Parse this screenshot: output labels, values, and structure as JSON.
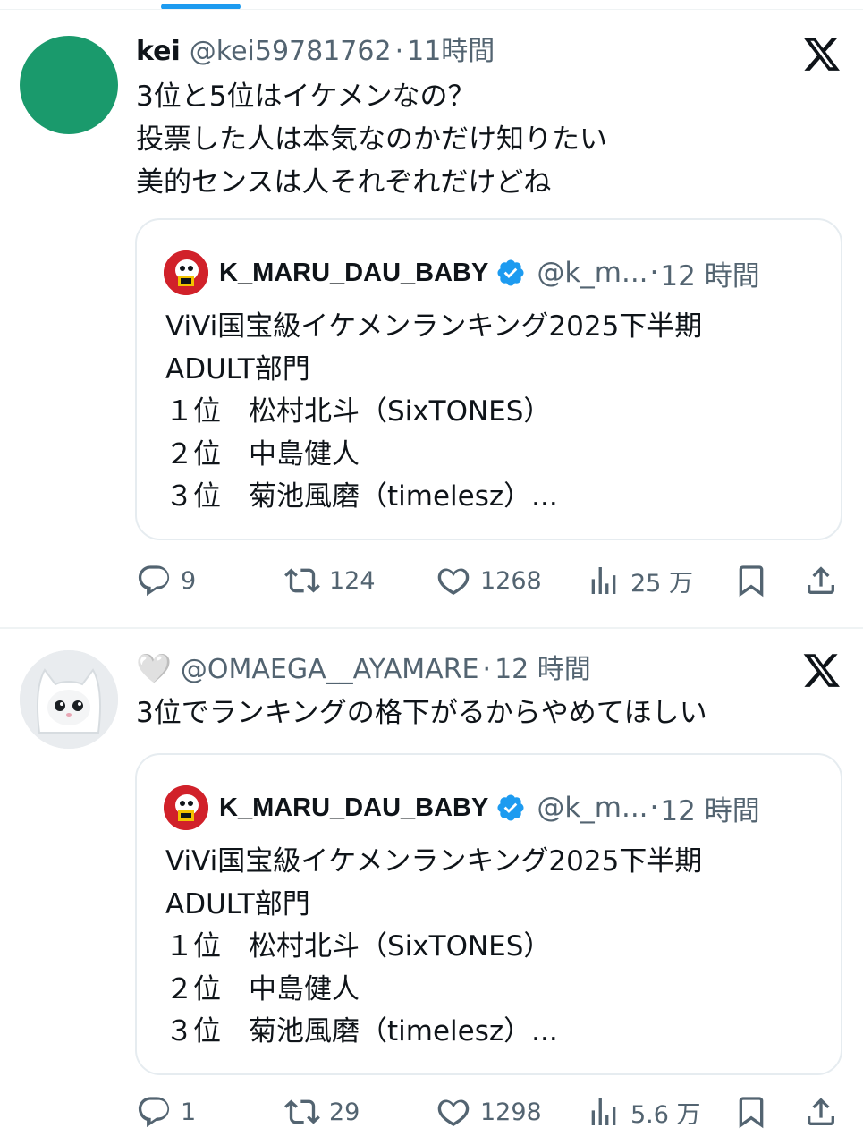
{
  "tweets": [
    {
      "name": "kei",
      "handle": "@kei59781762",
      "dot": "·",
      "time": "11時間",
      "text": "3位と5位はイケメンなの？\n投票した人は本気なのかだけ知りたい\n美的センスは人それぞれだけどね",
      "quote": {
        "name": "K_MARU_DAU_BABY",
        "handle": "@k_m...",
        "dot": "·",
        "time": "12 時間",
        "text": "ViVi国宝級イケメンランキング2025下半期\nADULT部門\n１位　松村北斗（SixTONES）\n２位　中島健人\n３位　菊池風磨（timelesz）..."
      },
      "stats": {
        "replies": "9",
        "retweets": "124",
        "likes": "1268",
        "views": "25 万"
      }
    },
    {
      "name": "🤍",
      "handle": "@OMAEGA__AYAMARE",
      "dot": "·",
      "time": "12 時間",
      "text": "3位でランキングの格下がるからやめてほしい",
      "quote": {
        "name": "K_MARU_DAU_BABY",
        "handle": "@k_m...",
        "dot": "·",
        "time": "12 時間",
        "text": "ViVi国宝級イケメンランキング2025下半期\nADULT部門\n１位　松村北斗（SixTONES）\n２位　中島健人\n３位　菊池風磨（timelesz）..."
      },
      "stats": {
        "replies": "1",
        "retweets": "29",
        "likes": "1298",
        "views": "5.6 万"
      }
    }
  ],
  "colors": {
    "accent": "#1d9bf0",
    "text": "#0f1419",
    "muted": "#536471",
    "border": "#e6ecf0",
    "avatar1": "#1a9a6c",
    "quote_avatar": "#d1212a"
  },
  "icons": {
    "brand": "x-logo-icon",
    "verified": "verified-badge-icon",
    "reply": "reply-icon",
    "retweet": "retweet-icon",
    "like": "heart-icon",
    "views": "views-icon",
    "bookmark": "bookmark-icon",
    "share": "share-icon"
  }
}
